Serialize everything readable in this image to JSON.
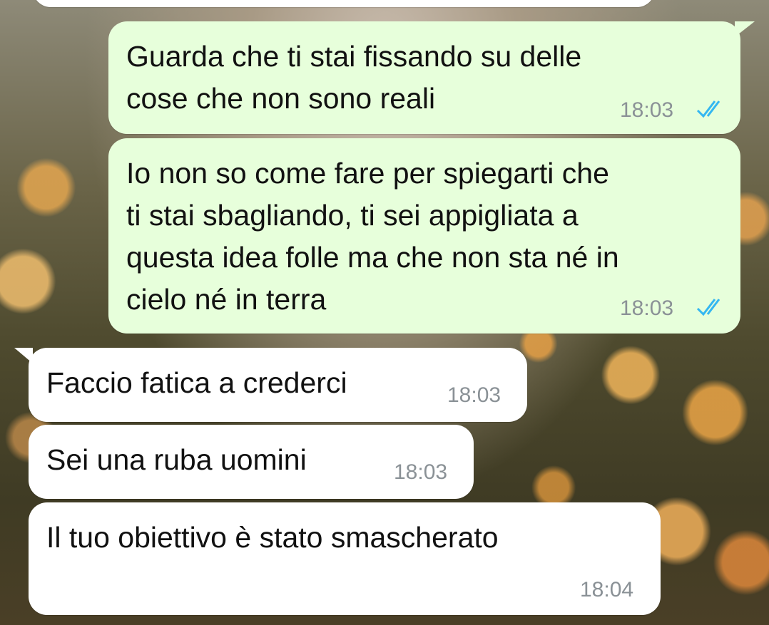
{
  "messages": [
    {
      "direction": "outgoing",
      "text": "Guarda che ti stai fissando su delle\ncose che non sono reali",
      "time": "18:03",
      "status_icon": "double-check-read-icon"
    },
    {
      "direction": "outgoing",
      "text": "Io non so come fare per spiegarti che\nti stai sbagliando, ti sei appigliata a\nquesta idea folle ma che non sta né in\ncielo né in terra",
      "time": "18:03",
      "status_icon": "double-check-read-icon"
    },
    {
      "direction": "incoming",
      "text": "Faccio fatica a crederci",
      "time": "18:03"
    },
    {
      "direction": "incoming",
      "text": "Sei una ruba uomini",
      "time": "18:03"
    },
    {
      "direction": "incoming",
      "text": "Il tuo obiettivo è stato smascherato",
      "time": "18:04"
    }
  ],
  "colors": {
    "outgoing_bubble": "#e7ffdb",
    "incoming_bubble": "#ffffff",
    "read_ticks": "#34b7f1",
    "timestamp": "#8a9196"
  }
}
